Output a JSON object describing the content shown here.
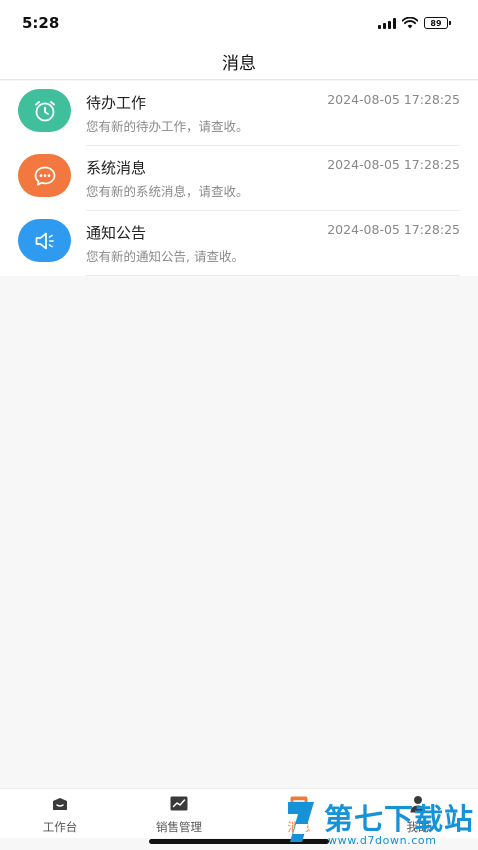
{
  "status_bar": {
    "time": "5:28",
    "battery": "89"
  },
  "header": {
    "title": "消息"
  },
  "messages": [
    {
      "title": "待办工作",
      "time": "2024-08-05 17:28:25",
      "desc": "您有新的待办工作，请查收。",
      "icon": "alarm-clock-icon",
      "color": "#3fbf9c"
    },
    {
      "title": "系统消息",
      "time": "2024-08-05 17:28:25",
      "desc": "您有新的系统消息，请查收。",
      "icon": "chat-bubble-icon",
      "color": "#f2783f"
    },
    {
      "title": "通知公告",
      "time": "2024-08-05 17:28:25",
      "desc": "您有新的通知公告, 请查收。",
      "icon": "speaker-icon",
      "color": "#2f9bf0"
    }
  ],
  "tabbar": {
    "items": [
      {
        "label": "工作台",
        "icon": "workbench-icon"
      },
      {
        "label": "销售管理",
        "icon": "sales-chart-icon"
      },
      {
        "label": "消息",
        "icon": "message-icon"
      },
      {
        "label": "我的",
        "icon": "profile-icon"
      }
    ]
  },
  "watermark": {
    "cn": "第七下载站",
    "url": "www.d7down.com"
  }
}
